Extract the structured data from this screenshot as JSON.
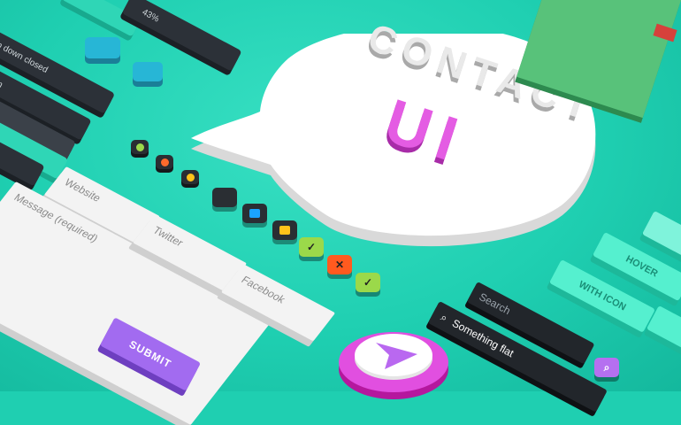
{
  "bubble": {
    "line1": "CONTACT",
    "line2": "UI"
  },
  "bars": {
    "progress_label": "43%",
    "dropdown_closed": "Drop down closed",
    "dropdown_open": "open"
  },
  "form": {
    "website_placeholder": "Website",
    "message_placeholder": "Message (required)",
    "twitter_placeholder": "Twitter",
    "facebook_placeholder": "Facebook",
    "submit_label": "SUBMIT"
  },
  "search": {
    "search_placeholder": "Search",
    "flat_value": "Something flat"
  },
  "buttons": {
    "hover_label": "HOVER",
    "with_icon_label": "WITH ICON"
  },
  "colors": {
    "background": "#1fcfb1",
    "accent_pink": "#e14fe0",
    "accent_purple": "#a26bf0",
    "dark": "#2c3138"
  }
}
